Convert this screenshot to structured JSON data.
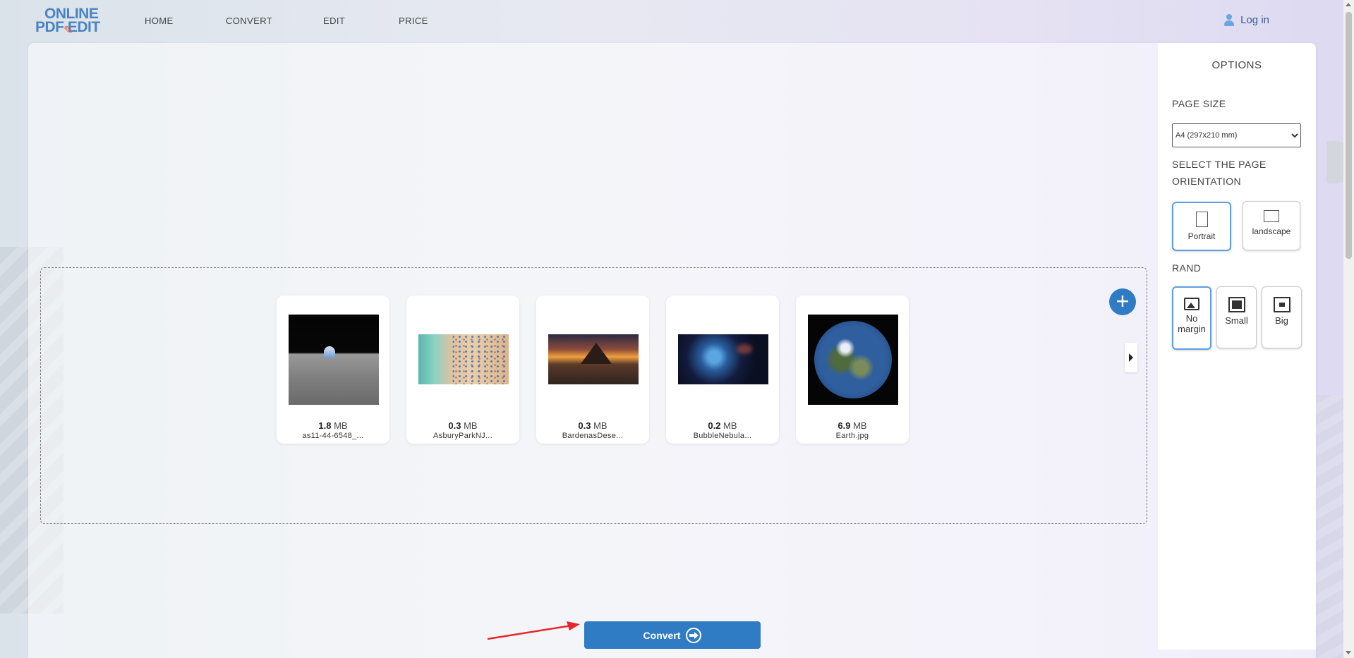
{
  "header": {
    "logo_line1": "ONLINE",
    "logo_line2": "PDF EDIT",
    "nav": [
      "HOME",
      "CONVERT",
      "EDIT",
      "PRICE"
    ],
    "login_label": "Log in"
  },
  "options": {
    "title": "OPTIONS",
    "page_size_label": "PAGE SIZE",
    "page_size_value": "A4 (297x210 mm)",
    "orientation_label": "SELECT THE PAGE ORIENTATION",
    "orientation": [
      {
        "label": "Portrait",
        "active": true
      },
      {
        "label": "landscape",
        "active": false
      }
    ],
    "rand_label": "RAND",
    "rand": [
      {
        "label": "No margin",
        "active": true
      },
      {
        "label": "Small",
        "active": false
      },
      {
        "label": "Big",
        "active": false
      }
    ]
  },
  "files": [
    {
      "size": "1.8",
      "unit": "MB",
      "name": "as11-44-6548_..."
    },
    {
      "size": "0.3",
      "unit": "MB",
      "name": "AsburyParkNJ..."
    },
    {
      "size": "0.3",
      "unit": "MB",
      "name": "BardenasDese..."
    },
    {
      "size": "0.2",
      "unit": "MB",
      "name": "BubbleNebula..."
    },
    {
      "size": "6.9",
      "unit": "MB",
      "name": "Earth.jpg"
    }
  ],
  "convert_label": "Convert",
  "colors": {
    "primary": "#2f7bc4",
    "accent_border": "#5e9ee0",
    "arrow": "#e8262b"
  }
}
